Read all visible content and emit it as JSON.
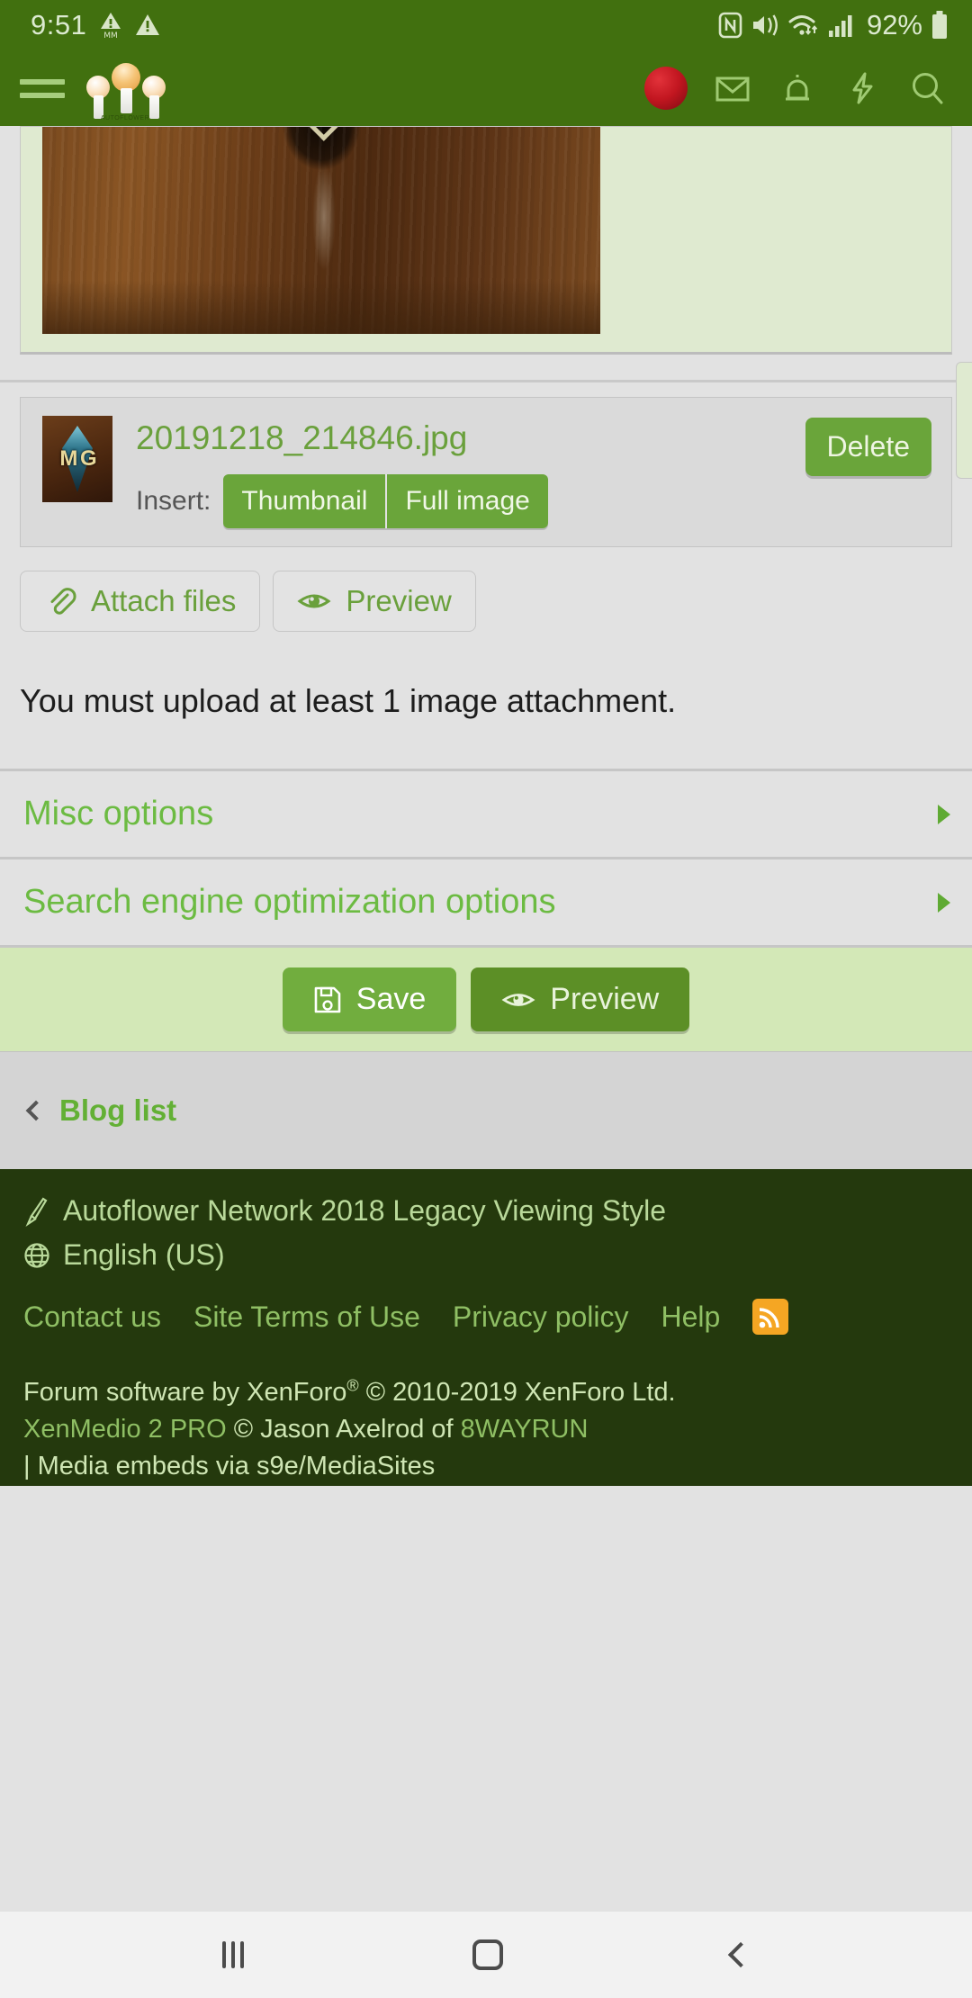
{
  "statusbar": {
    "clock": "9:51",
    "battery_percent": "92%",
    "icons": [
      "warning-mm-icon",
      "warning-triangle-icon",
      "nfc-icon",
      "vibrate-icon",
      "wifi-icon",
      "cellular-signal-icon",
      "battery-icon"
    ]
  },
  "header": {
    "menu_icon": "hamburger-menu-icon",
    "logo_caption": "AUTOFLOWER",
    "icons": [
      "user-avatar",
      "inbox-icon",
      "alerts-bell-icon",
      "whats-new-icon",
      "search-icon"
    ]
  },
  "attachment": {
    "filename": "20191218_214846.jpg",
    "insert_label": "Insert:",
    "thumbnail_label": "Thumbnail",
    "full_image_label": "Full image",
    "delete_label": "Delete",
    "thumb_text": "M G"
  },
  "tools": {
    "attach_label": "Attach files",
    "preview_label": "Preview"
  },
  "notice": "You must upload at least 1 image attachment.",
  "options": [
    {
      "label": "Misc options"
    },
    {
      "label": "Search engine optimization options"
    }
  ],
  "submit": {
    "save_label": "Save",
    "preview_label": "Preview"
  },
  "nav": {
    "blog_list_label": "Blog list"
  },
  "footer": {
    "style_label": "Autoflower Network 2018 Legacy Viewing Style",
    "language_label": "English (US)",
    "links": [
      "Contact us",
      "Site Terms of Use",
      "Privacy policy",
      "Help"
    ],
    "rss_label": "rss-icon",
    "copyright_line1_a": "Forum software by XenForo",
    "copyright_line1_sup": "®",
    "copyright_line1_b": " © 2010-2019 XenForo Ltd.",
    "copyright_line2_a": "XenMedio 2 PRO",
    "copyright_line2_b": " © Jason Axelrod of ",
    "copyright_line2_c": "8WAYRUN",
    "copyright_line3": "| Media embeds via s9e/MediaSites"
  },
  "colors": {
    "header_green": "#41700f",
    "accent_green": "#6aa53a",
    "link_green": "#6cbb42",
    "footer_dark": "#24390d",
    "panel_gray": "#e2e2e2",
    "editor_bg": "#dfead0"
  }
}
